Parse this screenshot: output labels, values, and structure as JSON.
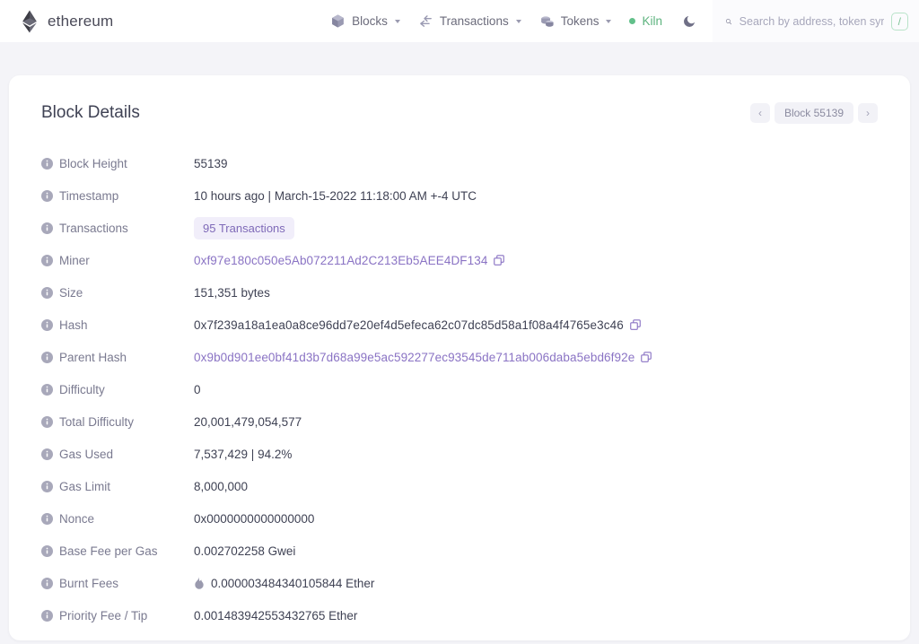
{
  "navbar": {
    "brand": "ethereum",
    "brand_logo_icon": "ethereum-logo-icon",
    "menu": [
      {
        "label": "Blocks",
        "icon": "cube-icon"
      },
      {
        "label": "Transactions",
        "icon": "arrow-exchange-icon"
      },
      {
        "label": "Tokens",
        "icon": "coins-icon"
      }
    ],
    "network": {
      "label": "Kiln",
      "status_color": "#62c08a"
    },
    "theme_toggle_icon": "moon-icon",
    "search": {
      "placeholder": "Search by address, token symbol, n",
      "value": "",
      "icon": "search-icon",
      "shortcut": "/"
    }
  },
  "page": {
    "title": "Block Details",
    "pager": {
      "prev_icon": "chevron-left-icon",
      "next_icon": "chevron-right-icon",
      "current_label": "Block 55139"
    }
  },
  "details": [
    {
      "label": "Block Height",
      "value": "55139",
      "type": "text"
    },
    {
      "label": "Timestamp",
      "value": "10 hours ago | March-15-2022 11:18:00 AM +-4 UTC",
      "type": "text"
    },
    {
      "label": "Transactions",
      "value": "95 Transactions",
      "type": "badge"
    },
    {
      "label": "Miner",
      "value": "0xf97e180c050e5Ab072211Ad2C213Eb5AEE4DF134",
      "type": "link-copy"
    },
    {
      "label": "Size",
      "value": "151,351 bytes",
      "type": "text"
    },
    {
      "label": "Hash",
      "value": "0x7f239a18a1ea0a8ce96dd7e20ef4d5efeca62c07dc85d58a1f08a4f4765e3c46",
      "type": "copy"
    },
    {
      "label": "Parent Hash",
      "value": "0x9b0d901ee0bf41d3b7d68a99e5ac592277ec93545de711ab006daba5ebd6f92e",
      "type": "link-copy"
    },
    {
      "label": "Difficulty",
      "value": "0",
      "type": "text"
    },
    {
      "label": "Total Difficulty",
      "value": "20,001,479,054,577",
      "type": "text"
    },
    {
      "label": "Gas Used",
      "value": "7,537,429 | 94.2%",
      "type": "text"
    },
    {
      "label": "Gas Limit",
      "value": "8,000,000",
      "type": "text"
    },
    {
      "label": "Nonce",
      "value": "0x0000000000000000",
      "type": "text"
    },
    {
      "label": "Base Fee per Gas",
      "value": "0.002702258 Gwei",
      "type": "text"
    },
    {
      "label": "Burnt Fees",
      "value": "0.000003484340105844 Ether",
      "type": "flame"
    },
    {
      "label": "Priority Fee / Tip",
      "value": "0.001483942553432765 Ether",
      "type": "text"
    }
  ],
  "colors": {
    "accent_purple": "#8a73c4",
    "badge_bg": "#f1eefa",
    "network_green": "#62c08a",
    "page_bg": "#f4f4f8"
  }
}
